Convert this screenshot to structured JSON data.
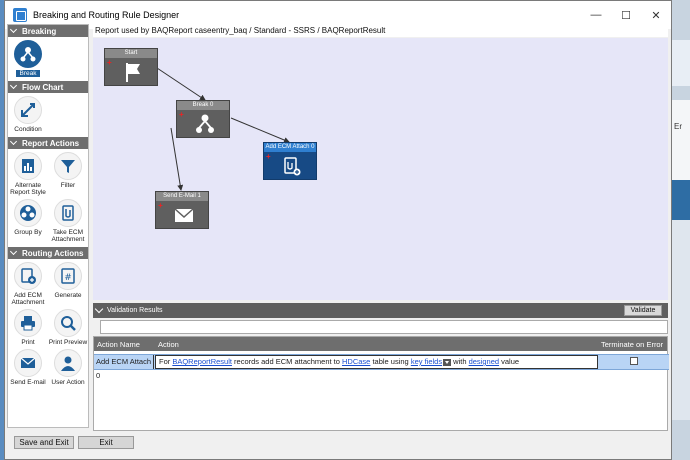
{
  "window": {
    "title": "Breaking and Routing Rule Designer",
    "minimize": "—",
    "maximize": "☐",
    "close": "✕"
  },
  "palette": {
    "sections": [
      {
        "header": "Breaking",
        "tools": [
          {
            "label": "Break",
            "icon": "break-icon"
          }
        ]
      },
      {
        "header": "Flow Chart",
        "tools": [
          {
            "label": "Condition",
            "icon": "condition-icon"
          }
        ]
      },
      {
        "header": "Report Actions",
        "tools": [
          {
            "label": "Alternate Report Style",
            "icon": "report-style-icon"
          },
          {
            "label": "Filter",
            "icon": "filter-icon"
          },
          {
            "label": "Group By",
            "icon": "group-by-icon"
          },
          {
            "label": "Take ECM Attachment",
            "icon": "attachment-icon"
          }
        ]
      },
      {
        "header": "Routing Actions",
        "tools": [
          {
            "label": "Add ECM Attachment",
            "icon": "add-attachment-icon"
          },
          {
            "label": "Generate",
            "icon": "generate-icon"
          },
          {
            "label": "Print",
            "icon": "printer-icon"
          },
          {
            "label": "Print Preview",
            "icon": "print-preview-icon"
          },
          {
            "label": "Send E-mail",
            "icon": "email-icon"
          },
          {
            "label": "User Action",
            "icon": "user-icon"
          }
        ]
      }
    ]
  },
  "breadcrumb": "Report used by BAQReport caseentry_baq / Standard - SSRS / BAQReportResult",
  "nodes": {
    "start": "Start",
    "break": "Break 0",
    "ecm": "Add ECM Attach 0",
    "email": "Send E-Mail 1"
  },
  "validation": {
    "header": "Validation Results",
    "validate_label": "Validate",
    "columns": {
      "action_name": "Action Name",
      "action": "Action",
      "terminate": "Terminate on Error"
    },
    "row": {
      "action_name": "Add ECM Attach 0",
      "t1": "For ",
      "l1": "BAQReportResult",
      "t2": " records add ECM attachment to ",
      "l2": "HDCase",
      "t3": " table using ",
      "l3": "key fields",
      "t4": " with ",
      "l4": "designed",
      "t5": " value"
    }
  },
  "footer": {
    "save_exit": "Save and Exit",
    "exit": "Exit"
  },
  "background": {
    "partial_text": "Er"
  },
  "colors": {
    "accent": "#1f5f99",
    "node_gray": "#5f5f5f",
    "node_blue": "#174a85",
    "canvas": "#e6e6f8",
    "link": "#1a4fd0"
  }
}
